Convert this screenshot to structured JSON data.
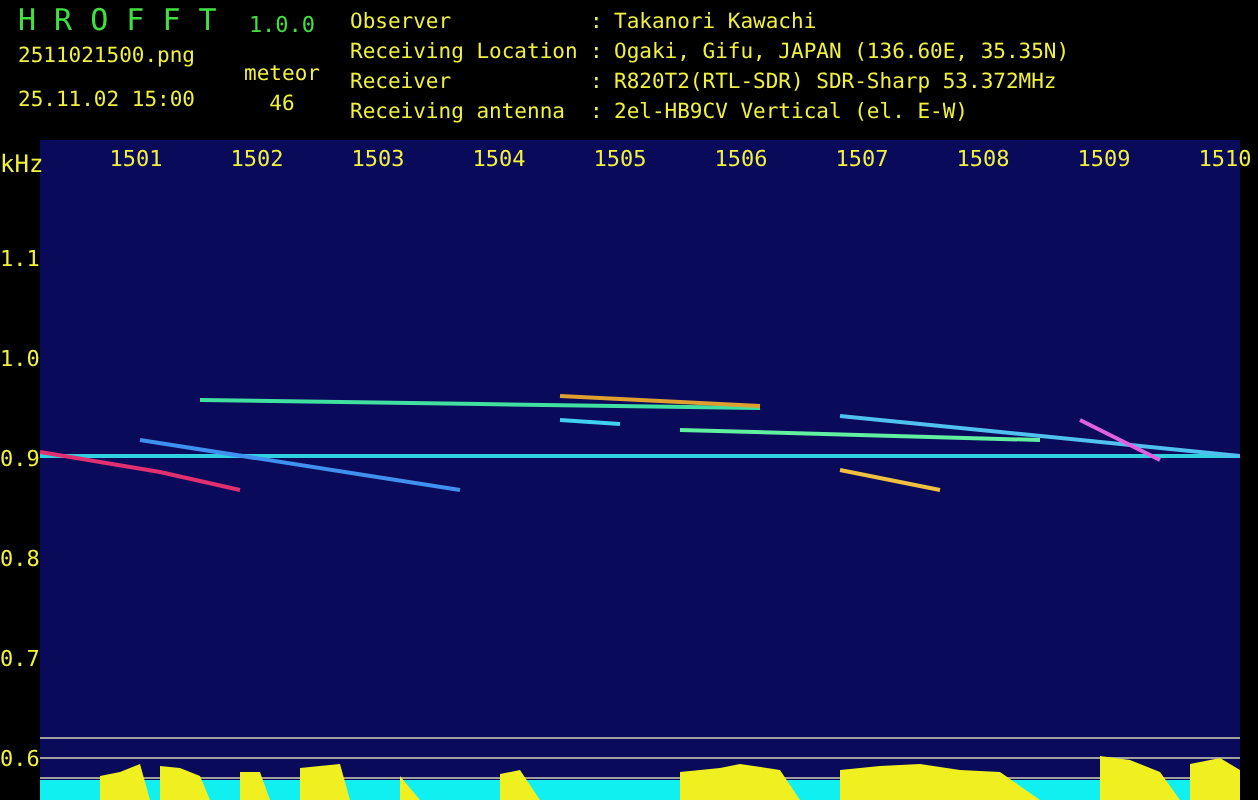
{
  "header": {
    "title": "H R O F F T",
    "version": "1.0.0",
    "filename": "2511021500.png",
    "datetime": "25.11.02 15:00",
    "counter_label": "meteor",
    "counter_value": "46"
  },
  "info": [
    {
      "label": "Observer",
      "separator": ":",
      "value": "Takanori Kawachi"
    },
    {
      "label": "Receiving Location",
      "separator": ":",
      "value": "Ogaki, Gifu, JAPAN (136.60E, 35.35N)"
    },
    {
      "label": "Receiver",
      "separator": ":",
      "value": "R820T2(RTL-SDR) SDR-Sharp 53.372MHz"
    },
    {
      "label": "Receiving antenna",
      "separator": ":",
      "value": "2el-HB9CV Vertical (el. E-W)"
    }
  ],
  "time_labels": [
    "1501",
    "1502",
    "1503",
    "1504",
    "1505",
    "1506",
    "1507",
    "1508",
    "1509",
    "1510"
  ],
  "frequency_axis": {
    "unit": "kHz",
    "labels": [
      "1.1",
      "1.0",
      "0.9",
      "0.8",
      "0.7",
      "0.6"
    ]
  }
}
